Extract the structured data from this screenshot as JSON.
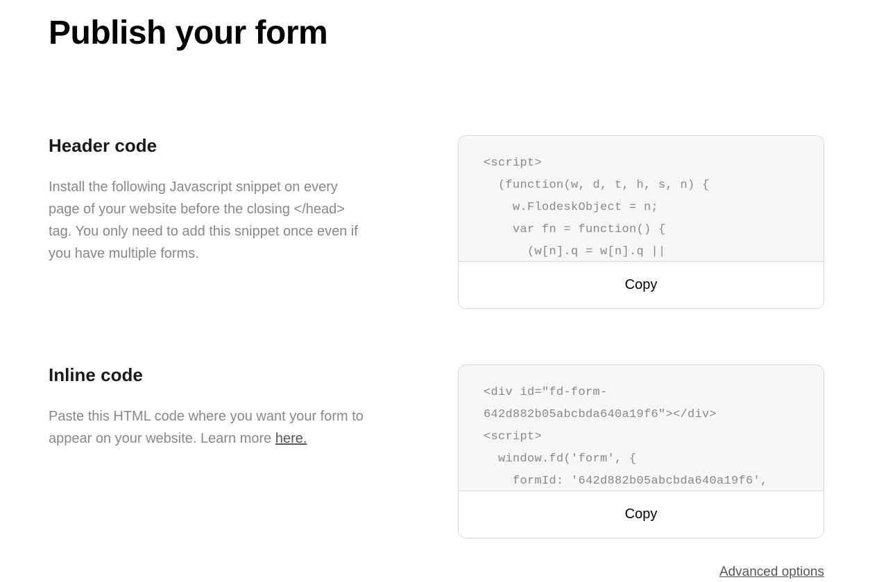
{
  "page_title": "Publish your form",
  "sections": {
    "header_code": {
      "title": "Header code",
      "description": "Install the following Javascript snippet on every page of your website before the closing </head> tag. You only need to add this snippet once even if you have multiple forms.",
      "code": "<script>\n  (function(w, d, t, h, s, n) {\n    w.FlodeskObject = n;\n    var fn = function() {\n      (w[n].q = w[n].q ||",
      "copy_label": "Copy"
    },
    "inline_code": {
      "title": "Inline code",
      "description_prefix": "Paste this HTML code where you want your form to appear on your website. Learn more ",
      "link_text": "here.",
      "code": "<div id=\"fd-form-\n642d882b05abcbda640a19f6\"></div>\n<script>\n  window.fd('form', {\n    formId: '642d882b05abcbda640a19f6',",
      "copy_label": "Copy"
    }
  },
  "advanced_options_label": "Advanced options"
}
